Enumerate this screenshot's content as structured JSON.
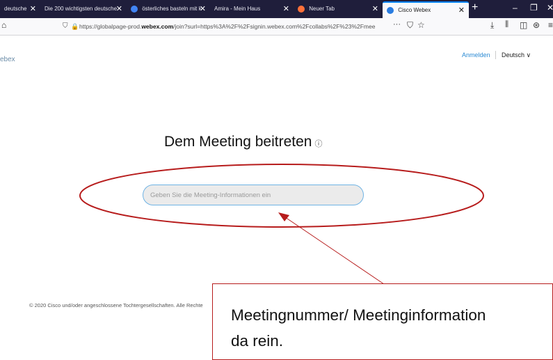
{
  "browser": {
    "tabs": [
      {
        "label": "deutsche",
        "color": ""
      },
      {
        "label": "Die 200 wichtigsten deutsche",
        "color": ""
      },
      {
        "label": "österliches basteln mit k",
        "color": "#4285f4"
      },
      {
        "label": "Amira - Mein Haus",
        "color": ""
      },
      {
        "label": "Neuer Tab",
        "color": "#ff7139"
      },
      {
        "label": "Cisco Webex",
        "color": "#2a7de1"
      }
    ],
    "new_tab": "+",
    "url_prefix": "https://globalpage-prod.",
    "url_domain": "webex.com",
    "url_rest": "/join?surl=https%3A%2F%2Fsignin.webex.com%2Fcollabs%2F%23%2Fmee",
    "url_more": "···"
  },
  "page": {
    "brand": "ebex",
    "signin": "Anmelden",
    "language": "Deutsch",
    "title": "Dem Meeting beitreten",
    "info_glyph": "ⓘ",
    "input_placeholder": "Geben Sie die Meeting-Informationen ein",
    "footer": "© 2020 Cisco und/oder angeschlossene Tochtergesellschaften. Alle Rechte"
  },
  "annotation": {
    "callout_line1": "Meetingnummer/ Meetinginformation",
    "callout_line2": "da rein.",
    "accent": "#b71c1c"
  }
}
